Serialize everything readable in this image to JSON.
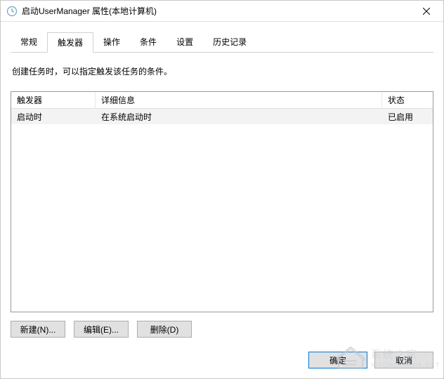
{
  "window": {
    "title": "启动UserManager 属性(本地计算机)"
  },
  "tabs": {
    "items": [
      {
        "label": "常规"
      },
      {
        "label": "触发器"
      },
      {
        "label": "操作"
      },
      {
        "label": "条件"
      },
      {
        "label": "设置"
      },
      {
        "label": "历史记录"
      }
    ],
    "active_index": 1
  },
  "instruction": "创建任务时，可以指定触发该任务的条件。",
  "table": {
    "headers": {
      "trigger": "触发器",
      "detail": "详细信息",
      "status": "状态"
    },
    "rows": [
      {
        "trigger": "启动时",
        "detail": "在系统启动时",
        "status": "已启用"
      }
    ]
  },
  "buttons": {
    "new": "新建(N)...",
    "edit": "编辑(E)...",
    "delete": "删除(D)"
  },
  "dialog": {
    "ok": "确定",
    "cancel": "取消"
  },
  "watermark": {
    "name": "系统之家",
    "url": "XITONGZHIJIA.NET"
  }
}
